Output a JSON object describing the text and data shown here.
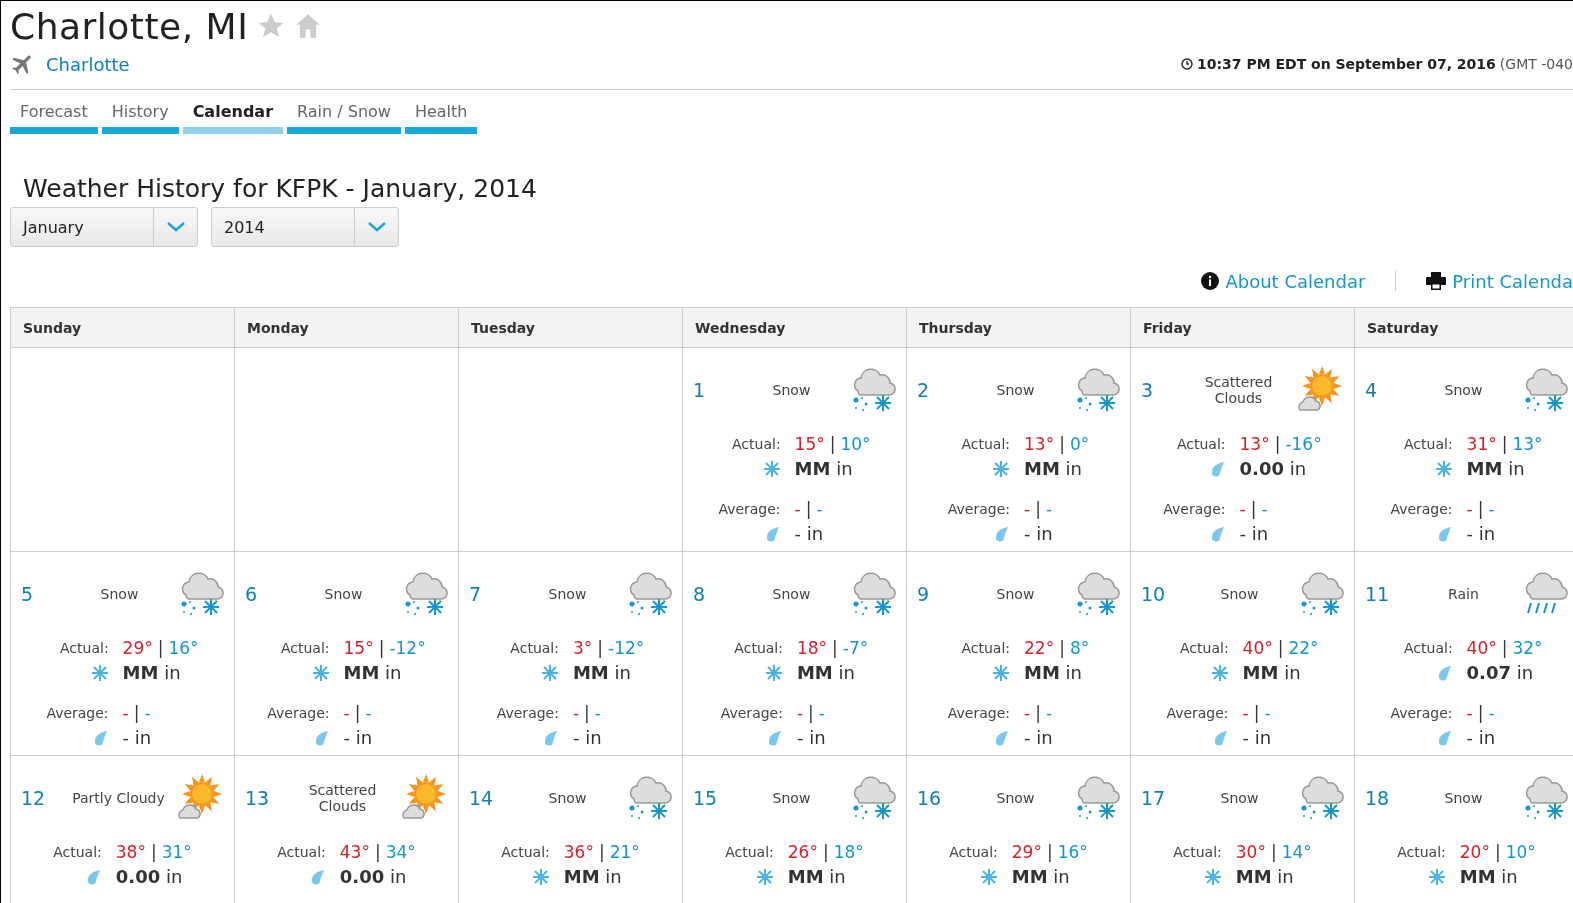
{
  "location": {
    "title": "Charlotte, MI",
    "favorite": false,
    "station_link": "Charlotte"
  },
  "timestamp": {
    "time": "10:37 PM EDT on September 07, 2016",
    "zone": "(GMT -040"
  },
  "tabs": [
    {
      "label": "Forecast",
      "selected": false
    },
    {
      "label": "History",
      "selected": false
    },
    {
      "label": "Calendar",
      "selected": true
    },
    {
      "label": "Rain / Snow",
      "selected": false
    },
    {
      "label": "Health",
      "selected": false
    }
  ],
  "heading": "Weather History for KFPK - January, 2014",
  "selects": [
    {
      "value": "January"
    },
    {
      "value": "2014"
    }
  ],
  "links": [
    {
      "kind": "info",
      "label": "About Calendar"
    },
    {
      "kind": "print",
      "label": "Print Calenda"
    }
  ],
  "weekdays": [
    "Sunday",
    "Monday",
    "Tuesday",
    "Wednesday",
    "Thursday",
    "Friday",
    "Saturday"
  ],
  "weeks": [
    {
      "days": [
        {
          "kind": "empty"
        },
        {
          "kind": "empty"
        },
        {
          "kind": "empty"
        },
        {
          "kind": "day",
          "day": "1",
          "condition": "Snow",
          "weather": {
            "kind": "snow"
          },
          "actual": {
            "label": "Actual:",
            "high": "15°",
            "sep": "|",
            "low": "10°"
          },
          "precip": {
            "kind": "snow",
            "text": "**MM** in"
          },
          "average": {
            "label": "Average:",
            "high": "-",
            "sep": "|",
            "low": "-",
            "precip": "- in"
          }
        },
        {
          "kind": "day",
          "day": "2",
          "condition": "Snow",
          "weather": {
            "kind": "snow"
          },
          "actual": {
            "label": "Actual:",
            "high": "13°",
            "sep": "|",
            "low": "0°"
          },
          "precip": {
            "kind": "snow",
            "text": "**MM** in"
          },
          "average": {
            "label": "Average:",
            "high": "-",
            "sep": "|",
            "low": "-",
            "precip": "- in"
          }
        },
        {
          "kind": "day",
          "day": "3",
          "condition": "Scattered Clouds",
          "weather": {
            "kind": "partly"
          },
          "actual": {
            "label": "Actual:",
            "high": "13°",
            "sep": "|",
            "low": "-16°"
          },
          "precip": {
            "kind": "rain",
            "text": "**0.00** in"
          },
          "average": {
            "label": "Average:",
            "high": "-",
            "sep": "|",
            "low": "-",
            "precip": "- in"
          }
        },
        {
          "kind": "day",
          "day": "4",
          "condition": "Snow",
          "weather": {
            "kind": "snow"
          },
          "actual": {
            "label": "Actual:",
            "high": "31°",
            "sep": "|",
            "low": "13°"
          },
          "precip": {
            "kind": "snow",
            "text": "**MM** in"
          },
          "average": {
            "label": "Average:",
            "high": "-",
            "sep": "|",
            "low": "-",
            "precip": "- in"
          }
        }
      ]
    },
    {
      "days": [
        {
          "kind": "day",
          "day": "5",
          "condition": "Snow",
          "weather": {
            "kind": "snow"
          },
          "actual": {
            "label": "Actual:",
            "high": "29°",
            "sep": "|",
            "low": "16°"
          },
          "precip": {
            "kind": "snow",
            "text": "**MM** in"
          },
          "average": {
            "label": "Average:",
            "high": "-",
            "sep": "|",
            "low": "-",
            "precip": "- in"
          }
        },
        {
          "kind": "day",
          "day": "6",
          "condition": "Snow",
          "weather": {
            "kind": "snow"
          },
          "actual": {
            "label": "Actual:",
            "high": "15°",
            "sep": "|",
            "low": "-12°"
          },
          "precip": {
            "kind": "snow",
            "text": "**MM** in"
          },
          "average": {
            "label": "Average:",
            "high": "-",
            "sep": "|",
            "low": "-",
            "precip": "- in"
          }
        },
        {
          "kind": "day",
          "day": "7",
          "condition": "Snow",
          "weather": {
            "kind": "snow"
          },
          "actual": {
            "label": "Actual:",
            "high": "3°",
            "sep": "|",
            "low": "-12°"
          },
          "precip": {
            "kind": "snow",
            "text": "**MM** in"
          },
          "average": {
            "label": "Average:",
            "high": "-",
            "sep": "|",
            "low": "-",
            "precip": "- in"
          }
        },
        {
          "kind": "day",
          "day": "8",
          "condition": "Snow",
          "weather": {
            "kind": "snow"
          },
          "actual": {
            "label": "Actual:",
            "high": "18°",
            "sep": "|",
            "low": "-7°"
          },
          "precip": {
            "kind": "snow",
            "text": "**MM** in"
          },
          "average": {
            "label": "Average:",
            "high": "-",
            "sep": "|",
            "low": "-",
            "precip": "- in"
          }
        },
        {
          "kind": "day",
          "day": "9",
          "condition": "Snow",
          "weather": {
            "kind": "snow"
          },
          "actual": {
            "label": "Actual:",
            "high": "22°",
            "sep": "|",
            "low": "8°"
          },
          "precip": {
            "kind": "snow",
            "text": "**MM** in"
          },
          "average": {
            "label": "Average:",
            "high": "-",
            "sep": "|",
            "low": "-",
            "precip": "- in"
          }
        },
        {
          "kind": "day",
          "day": "10",
          "condition": "Snow",
          "weather": {
            "kind": "snow"
          },
          "actual": {
            "label": "Actual:",
            "high": "40°",
            "sep": "|",
            "low": "22°"
          },
          "precip": {
            "kind": "snow",
            "text": "**MM** in"
          },
          "average": {
            "label": "Average:",
            "high": "-",
            "sep": "|",
            "low": "-",
            "precip": "- in"
          }
        },
        {
          "kind": "day",
          "day": "11",
          "condition": "Rain",
          "weather": {
            "kind": "rain"
          },
          "actual": {
            "label": "Actual:",
            "high": "40°",
            "sep": "|",
            "low": "32°"
          },
          "precip": {
            "kind": "rain",
            "text": "**0.07** in"
          },
          "average": {
            "label": "Average:",
            "high": "-",
            "sep": "|",
            "low": "-",
            "precip": "- in"
          }
        }
      ]
    },
    {
      "days": [
        {
          "kind": "day",
          "day": "12",
          "condition": "Partly Cloudy",
          "weather": {
            "kind": "partly"
          },
          "actual": {
            "label": "Actual:",
            "high": "38°",
            "sep": "|",
            "low": "31°"
          },
          "precip": {
            "kind": "rain",
            "text": "**0.00** in"
          }
        },
        {
          "kind": "day",
          "day": "13",
          "condition": "Scattered Clouds",
          "weather": {
            "kind": "partly"
          },
          "actual": {
            "label": "Actual:",
            "high": "43°",
            "sep": "|",
            "low": "34°"
          },
          "precip": {
            "kind": "rain",
            "text": "**0.00** in"
          }
        },
        {
          "kind": "day",
          "day": "14",
          "condition": "Snow",
          "weather": {
            "kind": "snow"
          },
          "actual": {
            "label": "Actual:",
            "high": "36°",
            "sep": "|",
            "low": "21°"
          },
          "precip": {
            "kind": "snow",
            "text": "**MM** in"
          }
        },
        {
          "kind": "day",
          "day": "15",
          "condition": "Snow",
          "weather": {
            "kind": "snow"
          },
          "actual": {
            "label": "Actual:",
            "high": "26°",
            "sep": "|",
            "low": "18°"
          },
          "precip": {
            "kind": "snow",
            "text": "**MM** in"
          }
        },
        {
          "kind": "day",
          "day": "16",
          "condition": "Snow",
          "weather": {
            "kind": "snow"
          },
          "actual": {
            "label": "Actual:",
            "high": "29°",
            "sep": "|",
            "low": "16°"
          },
          "precip": {
            "kind": "snow",
            "text": "**MM** in"
          }
        },
        {
          "kind": "day",
          "day": "17",
          "condition": "Snow",
          "weather": {
            "kind": "snow"
          },
          "actual": {
            "label": "Actual:",
            "high": "30°",
            "sep": "|",
            "low": "14°"
          },
          "precip": {
            "kind": "snow",
            "text": "**MM** in"
          }
        },
        {
          "kind": "day",
          "day": "18",
          "condition": "Snow",
          "weather": {
            "kind": "snow"
          },
          "actual": {
            "label": "Actual:",
            "high": "20°",
            "sep": "|",
            "low": "10°"
          },
          "precip": {
            "kind": "snow",
            "text": "**MM** in"
          }
        }
      ]
    }
  ]
}
